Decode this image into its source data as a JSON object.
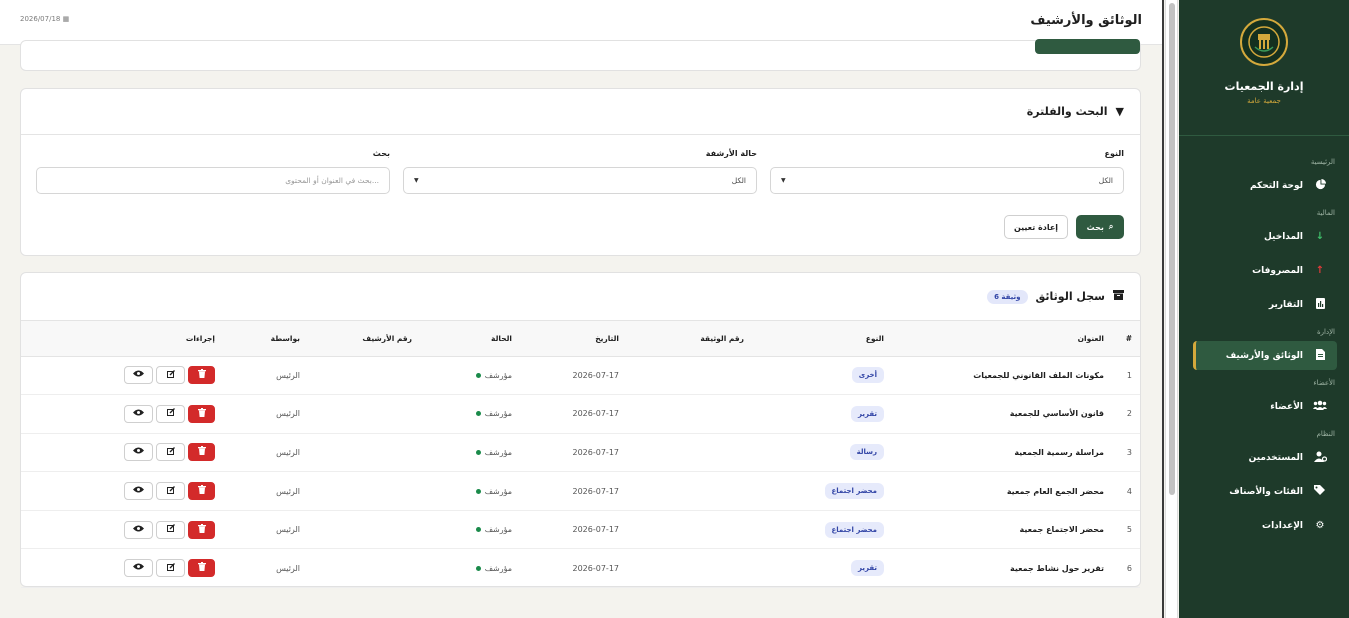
{
  "header": {
    "title": "الوثائق والأرشيف",
    "date": "2026/07/18"
  },
  "brand": {
    "name": "إدارة الجمعيات",
    "subtitle": "جمعية عامة"
  },
  "sidebar": {
    "sections": [
      {
        "title": "الرئيسية",
        "items": [
          {
            "label": "لوحة التحكم",
            "icon": "chart-pie-icon"
          }
        ]
      },
      {
        "title": "المالية",
        "items": [
          {
            "label": "المداخيل",
            "icon": "arrow-down-icon"
          },
          {
            "label": "المصروفات",
            "icon": "arrow-up-icon"
          },
          {
            "label": "التقارير",
            "icon": "report-file-icon"
          }
        ]
      },
      {
        "title": "الإدارة",
        "items": [
          {
            "label": "الوثائق والأرشيف",
            "icon": "document-icon"
          }
        ]
      },
      {
        "title": "الأعضاء",
        "items": [
          {
            "label": "الأعضاء",
            "icon": "users-icon"
          }
        ]
      },
      {
        "title": "النظام",
        "items": [
          {
            "label": "المستخدمين",
            "icon": "user-gear-icon"
          },
          {
            "label": "الفئات والأصناف",
            "icon": "tags-icon"
          },
          {
            "label": "الإعدادات",
            "icon": "gear-icon"
          }
        ]
      }
    ]
  },
  "filters": {
    "title": "البحث والفلترة",
    "type_label": "النوع",
    "type_value": "الكل",
    "archive_label": "حالة الأرشفة",
    "archive_value": "الكل",
    "search_label": "بحث",
    "search_placeholder": "بحث في العنوان أو المحتوى...",
    "search_button": "بحث",
    "reset_button": "إعادة تعيين"
  },
  "registry": {
    "title": "سجل الوثائق",
    "count": "6 وثيقة",
    "columns": [
      "#",
      "العنوان",
      "النوع",
      "رقم الوثيقة",
      "التاريخ",
      "الحالة",
      "رقم الأرشيف",
      "بواسطة",
      "إجراءات"
    ],
    "rows": [
      {
        "num": "1",
        "title": "مكونات الملف القانوني للجمعيات",
        "type": "أخرى",
        "doc_no": "",
        "date": "2026-07-17",
        "status": "مؤرشف",
        "archive_no": "",
        "by": "الرئيس"
      },
      {
        "num": "2",
        "title": "قانون الأساسي للجمعية",
        "type": "تقرير",
        "doc_no": "",
        "date": "2026-07-17",
        "status": "مؤرشف",
        "archive_no": "",
        "by": "الرئيس"
      },
      {
        "num": "3",
        "title": "مراسلة رسمية الجمعية",
        "type": "رسالة",
        "doc_no": "",
        "date": "2026-07-17",
        "status": "مؤرشف",
        "archive_no": "",
        "by": "الرئيس"
      },
      {
        "num": "4",
        "title": "محضر الجمع العام جمعية",
        "type": "محضر اجتماع",
        "doc_no": "",
        "date": "2026-07-17",
        "status": "مؤرشف",
        "archive_no": "",
        "by": "الرئيس"
      },
      {
        "num": "5",
        "title": "محضر الاجتماع جمعية",
        "type": "محضر اجتماع",
        "doc_no": "",
        "date": "2026-07-17",
        "status": "مؤرشف",
        "archive_no": "",
        "by": "الرئيس"
      },
      {
        "num": "6",
        "title": "تقرير حول نشاط جمعية",
        "type": "تقرير",
        "doc_no": "",
        "date": "2026-07-17",
        "status": "مؤرشف",
        "archive_no": "",
        "by": "الرئيس"
      }
    ]
  },
  "colors": {
    "brand": "#1e3a2a",
    "accent": "#d4a93c",
    "primary_button": "#2f5a40",
    "danger": "#d32a2a",
    "status_ok": "#1a8a4a"
  }
}
